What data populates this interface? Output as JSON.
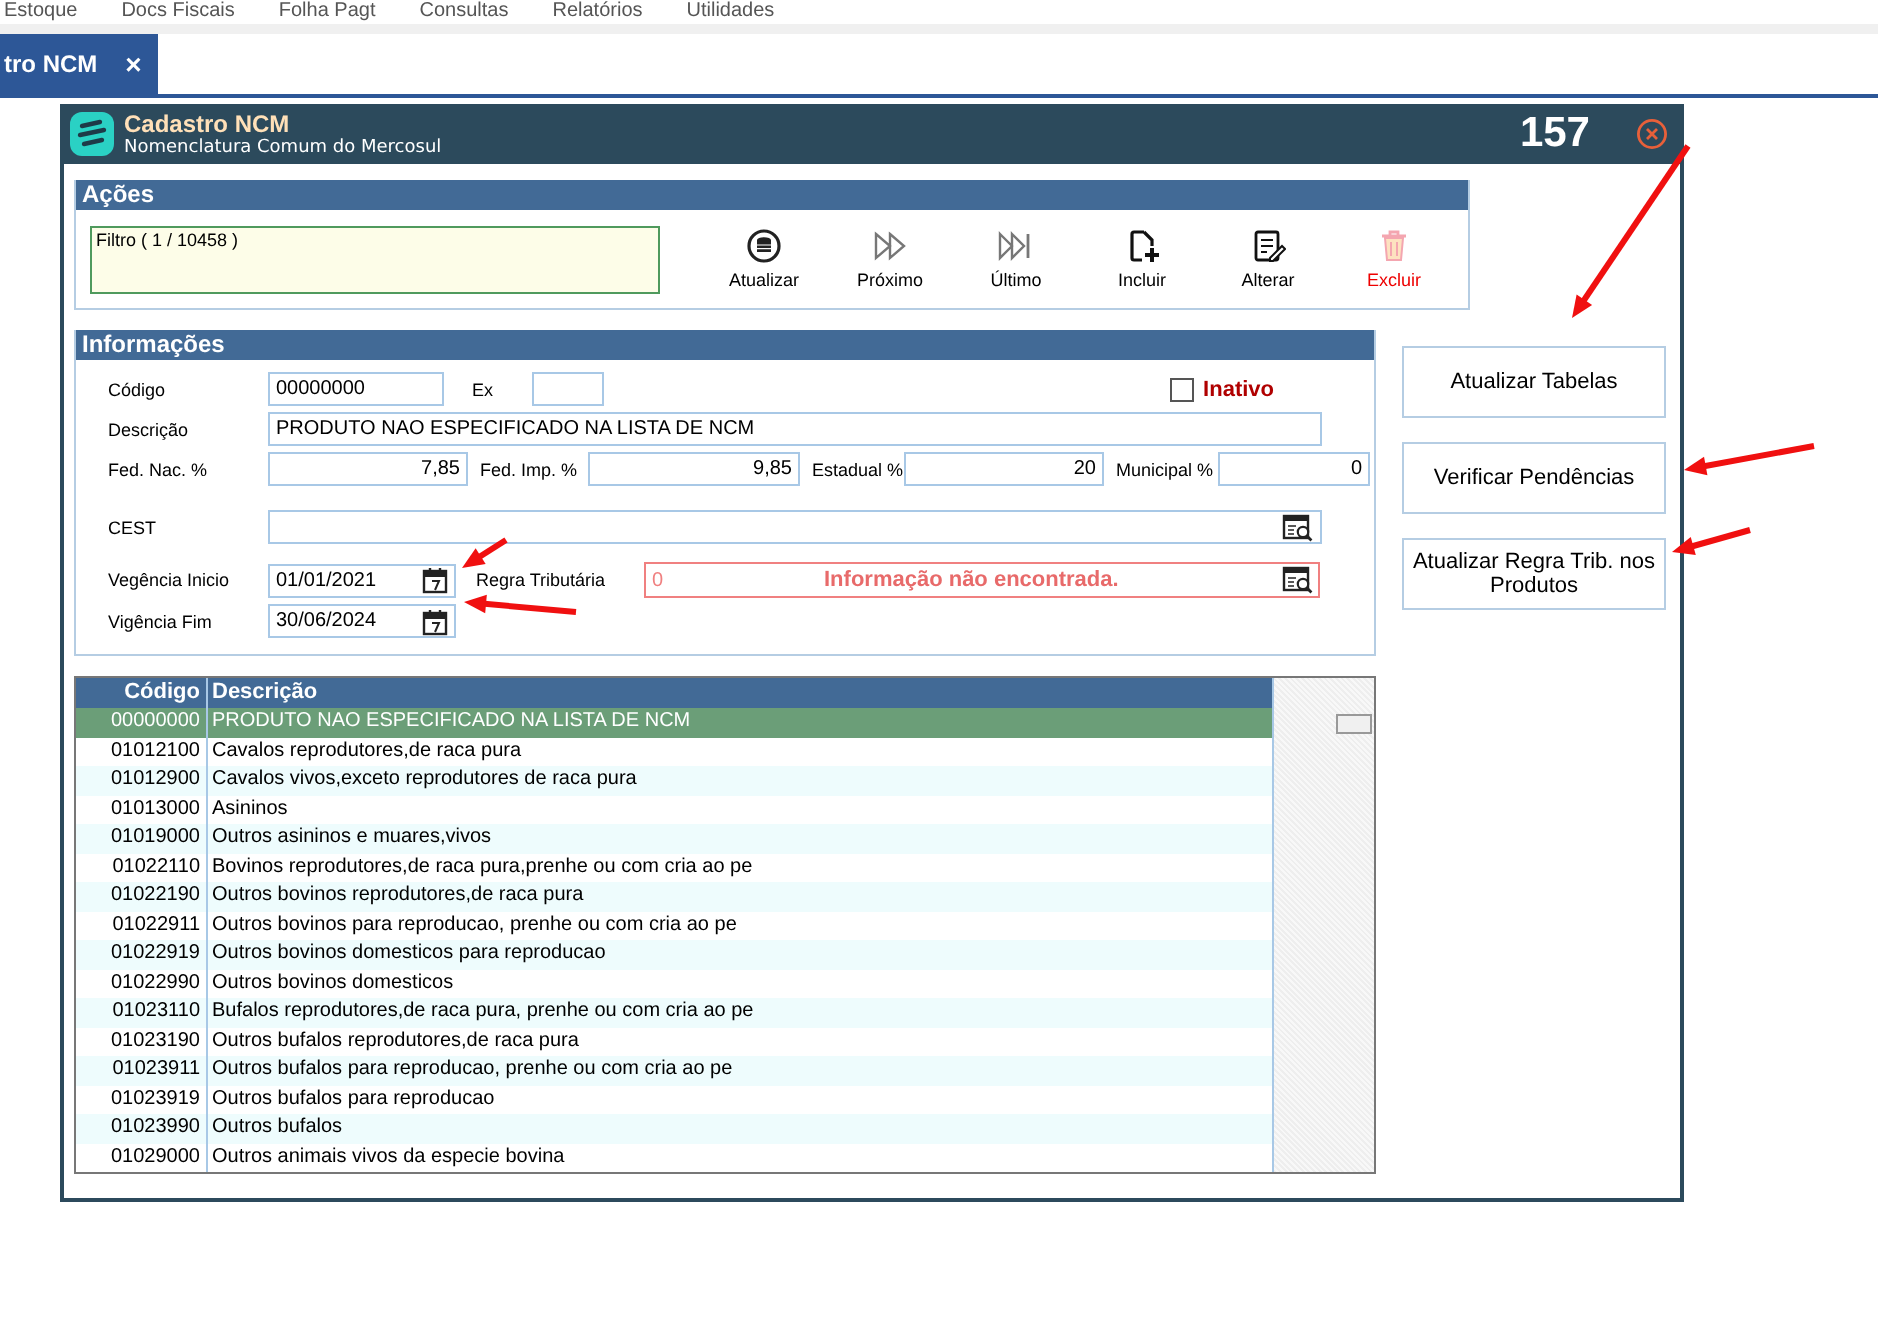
{
  "menu": [
    "Estoque",
    "Docs Fiscais",
    "Folha Pagt",
    "Consultas",
    "Relatórios",
    "Utilidades"
  ],
  "tab": {
    "label": "tro NCM",
    "close": "×"
  },
  "window": {
    "title": "Cadastro NCM",
    "subtitle": "Nomenclatura Comum do Mercosul",
    "counter": "157"
  },
  "actions": {
    "title": "Ações",
    "filter": "Filtro ( 1 / 10458 )",
    "buttons": [
      {
        "label": "Atualizar",
        "kind": "refresh"
      },
      {
        "label": "Próximo",
        "kind": "next"
      },
      {
        "label": "Último",
        "kind": "last"
      },
      {
        "label": "Incluir",
        "kind": "add"
      },
      {
        "label": "Alterar",
        "kind": "edit"
      },
      {
        "label": "Excluir",
        "kind": "delete"
      }
    ]
  },
  "info": {
    "title": "Informações",
    "codigo": {
      "label": "Código",
      "value": "00000000"
    },
    "ex": {
      "label": "Ex"
    },
    "inativo": {
      "label": "Inativo",
      "checked": false
    },
    "descricao": {
      "label": "Descrição",
      "value": "PRODUTO NAO ESPECIFICADO NA LISTA DE NCM"
    },
    "rates": [
      {
        "label": "Fed. Nac. %",
        "value": "7,85"
      },
      {
        "label": "Fed. Imp. %",
        "value": "9,85"
      },
      {
        "label": "Estadual %",
        "value": "20"
      },
      {
        "label": "Municipal %",
        "value": "0"
      }
    ],
    "cest": {
      "label": "CEST"
    },
    "vigencia_inicio": {
      "label": "Vegência Inicio",
      "value": "01/01/2021"
    },
    "vigencia_fim": {
      "label": "Vigência Fim",
      "value": "30/06/2024"
    },
    "regra": {
      "label": "Regra Tributária",
      "value": "0",
      "message": "Informação não encontrada."
    }
  },
  "table": {
    "columns": [
      "Código",
      "Descrição"
    ],
    "rows": [
      {
        "code": "00000000",
        "desc": "PRODUTO NAO ESPECIFICADO NA LISTA DE NCM",
        "selected": true
      },
      {
        "code": "01012100",
        "desc": "Cavalos reprodutores,de raca pura",
        "selected": false
      },
      {
        "code": "01012900",
        "desc": "Cavalos vivos,exceto reprodutores de raca pura",
        "selected": false
      },
      {
        "code": "01013000",
        "desc": "Asininos",
        "selected": false
      },
      {
        "code": "01019000",
        "desc": "Outros asininos e muares,vivos",
        "selected": false
      },
      {
        "code": "01022110",
        "desc": "Bovinos reprodutores,de raca pura,prenhe ou com cria ao pe",
        "selected": false
      },
      {
        "code": "01022190",
        "desc": "Outros bovinos reprodutores,de raca pura",
        "selected": false
      },
      {
        "code": "01022911",
        "desc": "Outros bovinos para reproducao, prenhe ou com cria ao pe",
        "selected": false
      },
      {
        "code": "01022919",
        "desc": "Outros bovinos domesticos para reproducao",
        "selected": false
      },
      {
        "code": "01022990",
        "desc": "Outros bovinos domesticos",
        "selected": false
      },
      {
        "code": "01023110",
        "desc": "Bufalos reprodutores,de raca pura, prenhe ou com cria ao pe",
        "selected": false
      },
      {
        "code": "01023190",
        "desc": "Outros bufalos reprodutores,de raca pura",
        "selected": false
      },
      {
        "code": "01023911",
        "desc": "Outros bufalos para reproducao, prenhe ou com cria ao pe",
        "selected": false
      },
      {
        "code": "01023919",
        "desc": "Outros bufalos para reproducao",
        "selected": false
      },
      {
        "code": "01023990",
        "desc": "Outros bufalos",
        "selected": false
      },
      {
        "code": "01029000",
        "desc": "Outros animais vivos da especie bovina",
        "selected": false
      }
    ]
  },
  "side_buttons": [
    "Atualizar Tabelas",
    "Verificar Pendências",
    "Atualizar Regra Trib. nos Produtos"
  ]
}
